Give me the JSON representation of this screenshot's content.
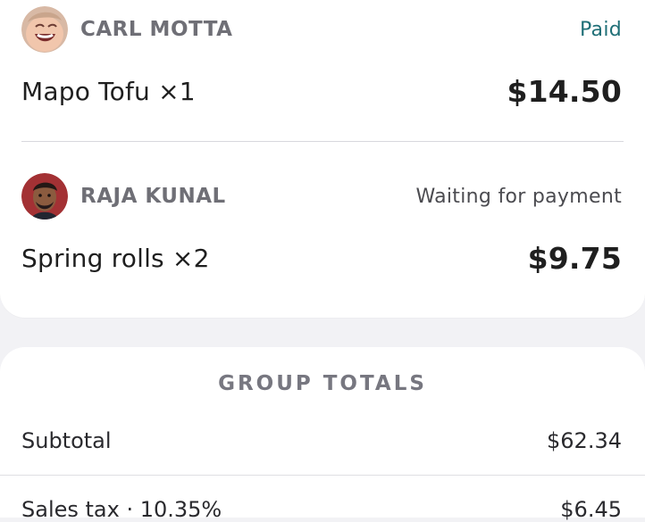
{
  "people": [
    {
      "name": "CARL MOTTA",
      "status": "Paid",
      "item": "Mapo Tofu ×1",
      "price": "$14.50",
      "avatar_icon": "avatar-smiling-person-icon"
    },
    {
      "name": "RAJA KUNAL",
      "status": "Waiting for payment",
      "item": "Spring rolls ×2",
      "price": "$9.75",
      "avatar_icon": "avatar-man-portrait-icon"
    }
  ],
  "totals": {
    "title": "GROUP TOTALS",
    "subtotal_label": "Subtotal",
    "subtotal_value": "$62.34",
    "tax_label": "Sales tax · 10.35%",
    "tax_value": "$6.45"
  },
  "colors": {
    "paid_status": "#1f6f77",
    "background": "#f2f2f5",
    "card": "#ffffff",
    "muted_text": "#6f6f76"
  }
}
